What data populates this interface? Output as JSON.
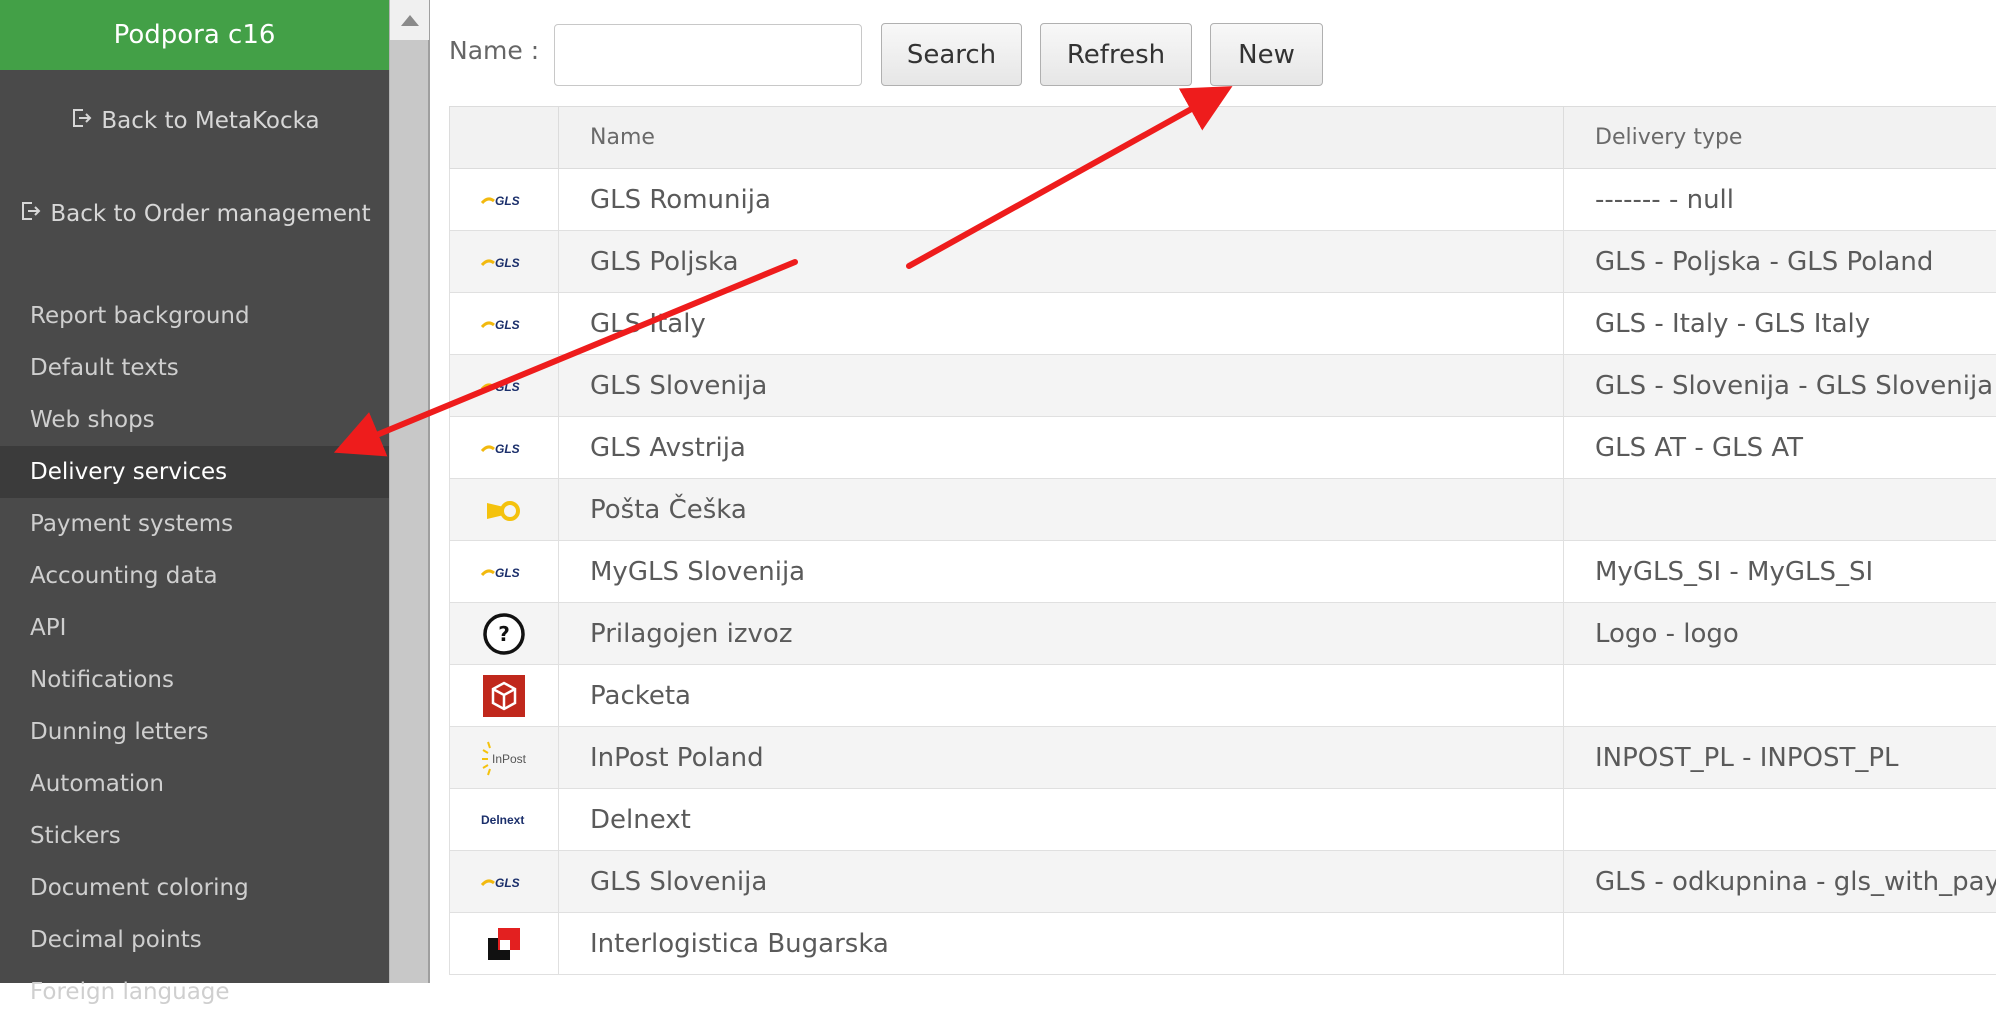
{
  "sidebar": {
    "title": "Podpora c16",
    "back_metakocka": "Back to MetaKocka",
    "back_order": "Back to Order management",
    "items": [
      {
        "label": "Report background",
        "active": false
      },
      {
        "label": "Default texts",
        "active": false
      },
      {
        "label": "Web shops",
        "active": false
      },
      {
        "label": "Delivery services",
        "active": true
      },
      {
        "label": "Payment systems",
        "active": false
      },
      {
        "label": "Accounting data",
        "active": false
      },
      {
        "label": "API",
        "active": false
      },
      {
        "label": "Notifications",
        "active": false
      },
      {
        "label": "Dunning letters",
        "active": false
      },
      {
        "label": "Automation",
        "active": false
      },
      {
        "label": "Stickers",
        "active": false
      },
      {
        "label": "Document coloring",
        "active": false
      },
      {
        "label": "Decimal points",
        "active": false
      },
      {
        "label": "Foreign language",
        "active": false
      }
    ]
  },
  "toolbar": {
    "name_label": "Name :",
    "name_value": "",
    "search_label": "Search",
    "refresh_label": "Refresh",
    "new_label": "New"
  },
  "table": {
    "columns": [
      "",
      "Name",
      "Delivery type"
    ],
    "rows": [
      {
        "logo": "gls-logo",
        "name": "GLS Romunija",
        "delivery_type": "------- - null"
      },
      {
        "logo": "gls-logo",
        "name": "GLS Poljska",
        "delivery_type": "GLS - Poljska - GLS Poland"
      },
      {
        "logo": "gls-logo",
        "name": "GLS Italy",
        "delivery_type": "GLS - Italy - GLS Italy"
      },
      {
        "logo": "gls-logo",
        "name": "GLS Slovenija",
        "delivery_type": "GLS - Slovenija - GLS Slovenija"
      },
      {
        "logo": "gls-logo",
        "name": "GLS Avstrija",
        "delivery_type": "GLS AT - GLS AT"
      },
      {
        "logo": "posta-horn-logo",
        "name": "Pošta Češka",
        "delivery_type": ""
      },
      {
        "logo": "gls-logo",
        "name": "MyGLS Slovenija",
        "delivery_type": "MyGLS_SI - MyGLS_SI"
      },
      {
        "logo": "question-icon",
        "name": "Prilagojen izvoz",
        "delivery_type": "Logo - logo"
      },
      {
        "logo": "packeta-logo",
        "name": "Packeta",
        "delivery_type": ""
      },
      {
        "logo": "inpost-logo",
        "name": "InPost Poland",
        "delivery_type": "INPOST_PL - INPOST_PL"
      },
      {
        "logo": "delnext-logo",
        "name": "Delnext",
        "delivery_type": ""
      },
      {
        "logo": "gls-logo",
        "name": "GLS Slovenija",
        "delivery_type": "GLS - odkupnina - gls_with_payment"
      },
      {
        "logo": "interlogistica-logo",
        "name": "Interlogistica Bugarska",
        "delivery_type": ""
      }
    ]
  },
  "logo_text": {
    "gls": "GLS",
    "inpost": "InPost",
    "delnext": "Delnext"
  },
  "colors": {
    "sidebar_bg": "#4a4a4a",
    "header_green": "#43a047",
    "arrow_red": "#ee1c1c",
    "gls_yellow": "#f2b90f",
    "gls_blue": "#1b2f6b"
  }
}
